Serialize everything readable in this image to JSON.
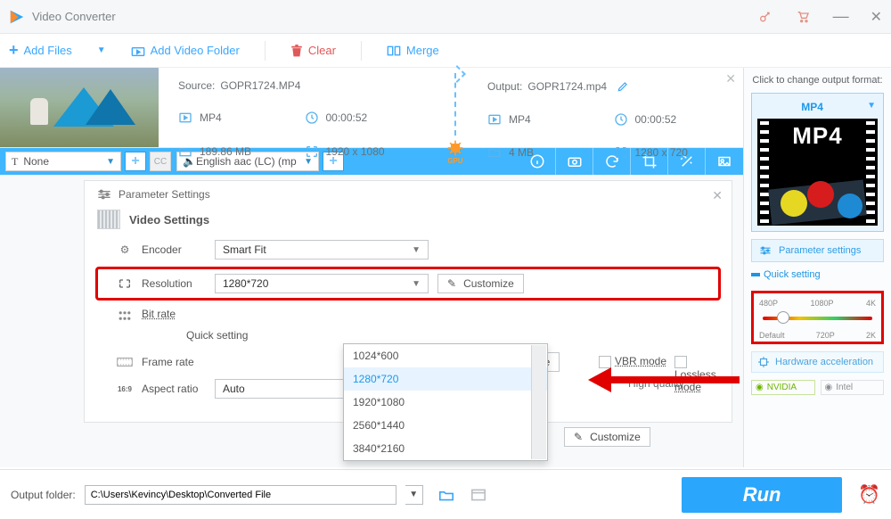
{
  "app": {
    "title": "Video Converter"
  },
  "toolbar": {
    "add_files": "Add Files",
    "add_folder": "Add Video Folder",
    "clear": "Clear",
    "merge": "Merge"
  },
  "source": {
    "label": "Source:",
    "filename": "GOPR1724.MP4",
    "format": "MP4",
    "duration": "00:00:52",
    "size": "189.86 MB",
    "resolution": "1920 x 1080"
  },
  "output": {
    "label": "Output:",
    "filename": "GOPR1724.mp4",
    "format": "MP4",
    "duration": "00:00:52",
    "size": "4 MB",
    "resolution": "1280 x 720"
  },
  "gpu_label": "GPU",
  "bluebar": {
    "text_track": "None",
    "audio_track": "English aac (LC) (mp"
  },
  "panel": {
    "title": "Parameter Settings",
    "section": "Video Settings",
    "encoder": {
      "label": "Encoder",
      "value": "Smart Fit"
    },
    "resolution": {
      "label": "Resolution",
      "value": "1280*720",
      "customize": "Customize"
    },
    "bitrate": {
      "label": "Bit rate",
      "quick": "Quick setting",
      "customize": "ize",
      "high_quality": "High quality",
      "vbr": "VBR mode",
      "lossless": "Lossless mode"
    },
    "framerate": {
      "label": "Frame rate",
      "customize": "Customize"
    },
    "aspect": {
      "label": "Aspect ratio",
      "value": "Auto"
    },
    "res_options": [
      "1024*600",
      "1280*720",
      "1920*1080",
      "2560*1440",
      "3840*2160"
    ]
  },
  "right": {
    "click_text": "Click to change output format:",
    "format": "MP4",
    "big_label": "MP4",
    "param": "Parameter settings",
    "quick": "Quick setting",
    "slider": {
      "t480": "480P",
      "t720": "720P",
      "t1080": "1080P",
      "t2k": "2K",
      "t4k": "4K",
      "def": "Default"
    },
    "hw": "Hardware acceleration",
    "nvidia": "NVIDIA",
    "intel": "Intel"
  },
  "bottom": {
    "label": "Output folder:",
    "path": "C:\\Users\\Kevincy\\Desktop\\Converted File",
    "run": "Run"
  }
}
